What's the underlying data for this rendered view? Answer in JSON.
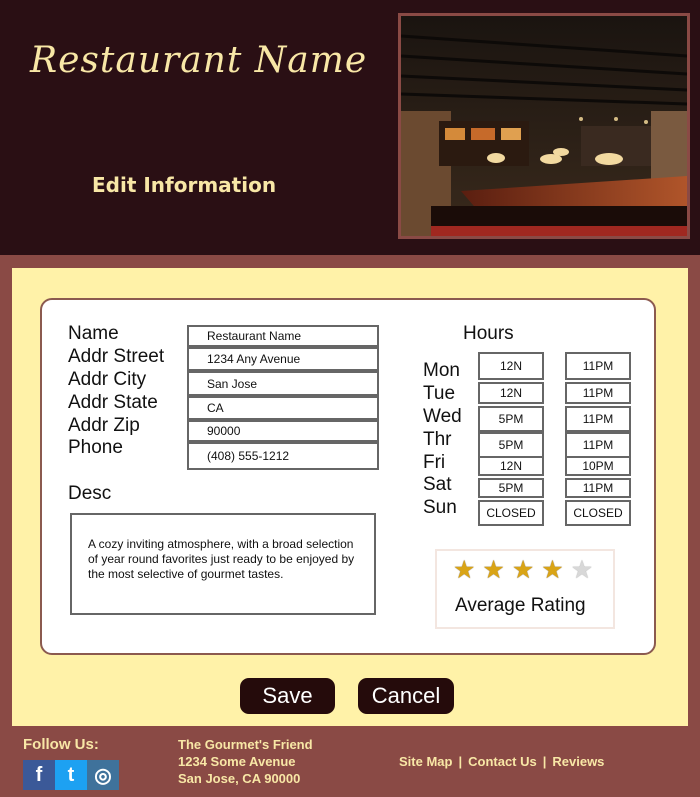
{
  "header": {
    "logo": "Restaurant Name",
    "edit_title": "Edit Information"
  },
  "form": {
    "labels": {
      "name": "Name",
      "street": "Addr Street",
      "city": "Addr City",
      "state": "Addr State",
      "zip": "Addr Zip",
      "phone": "Phone",
      "desc": "Desc"
    },
    "values": {
      "name": "Restaurant Name",
      "street": "1234 Any Avenue",
      "city": "San Jose",
      "state": "CA",
      "zip": "90000",
      "phone": "(408) 555-1212"
    },
    "desc": "A cozy inviting atmosphere, with a broad selection of year round favorites just ready to be enjoyed by the most selective of gourmet tastes."
  },
  "hours": {
    "title": "Hours",
    "days": [
      {
        "day": "Mon",
        "open": "12N",
        "close": "11PM"
      },
      {
        "day": "Tue",
        "open": "12N",
        "close": "11PM"
      },
      {
        "day": "Wed",
        "open": "5PM",
        "close": "11PM"
      },
      {
        "day": "Thr",
        "open": "5PM",
        "close": "11PM"
      },
      {
        "day": "Fri",
        "open": "12N",
        "close": "10PM"
      },
      {
        "day": "Sat",
        "open": "5PM",
        "close": "11PM"
      },
      {
        "day": "Sun",
        "open": "CLOSED",
        "close": "CLOSED"
      }
    ]
  },
  "rating": {
    "label": "Average Rating",
    "value": 4,
    "max": 5,
    "star_glyph": "★"
  },
  "buttons": {
    "save": "Save",
    "cancel": "Cancel"
  },
  "footer": {
    "follow": "Follow Us:",
    "social_icons": [
      "facebook-icon",
      "twitter-icon",
      "instagram-icon"
    ],
    "social_glyphs": {
      "facebook": "f",
      "twitter": "t",
      "instagram": "◎"
    },
    "address": [
      "The Gourmet's Friend",
      "1234 Some Avenue",
      "San Jose, CA  90000"
    ],
    "links": [
      "Site Map",
      "Contact Us",
      "Reviews"
    ],
    "link_separator": "|"
  },
  "colors": {
    "header_bg": "#2a0f14",
    "accent_text": "#f8e7a6",
    "frame": "#8a4a45",
    "panel": "#fff2a8",
    "button": "#250b0b",
    "star_on": "#d9a416",
    "star_off": "#d8d8d8",
    "facebook": "#3b5998",
    "twitter": "#1da1f2",
    "instagram": "#3f729b"
  }
}
